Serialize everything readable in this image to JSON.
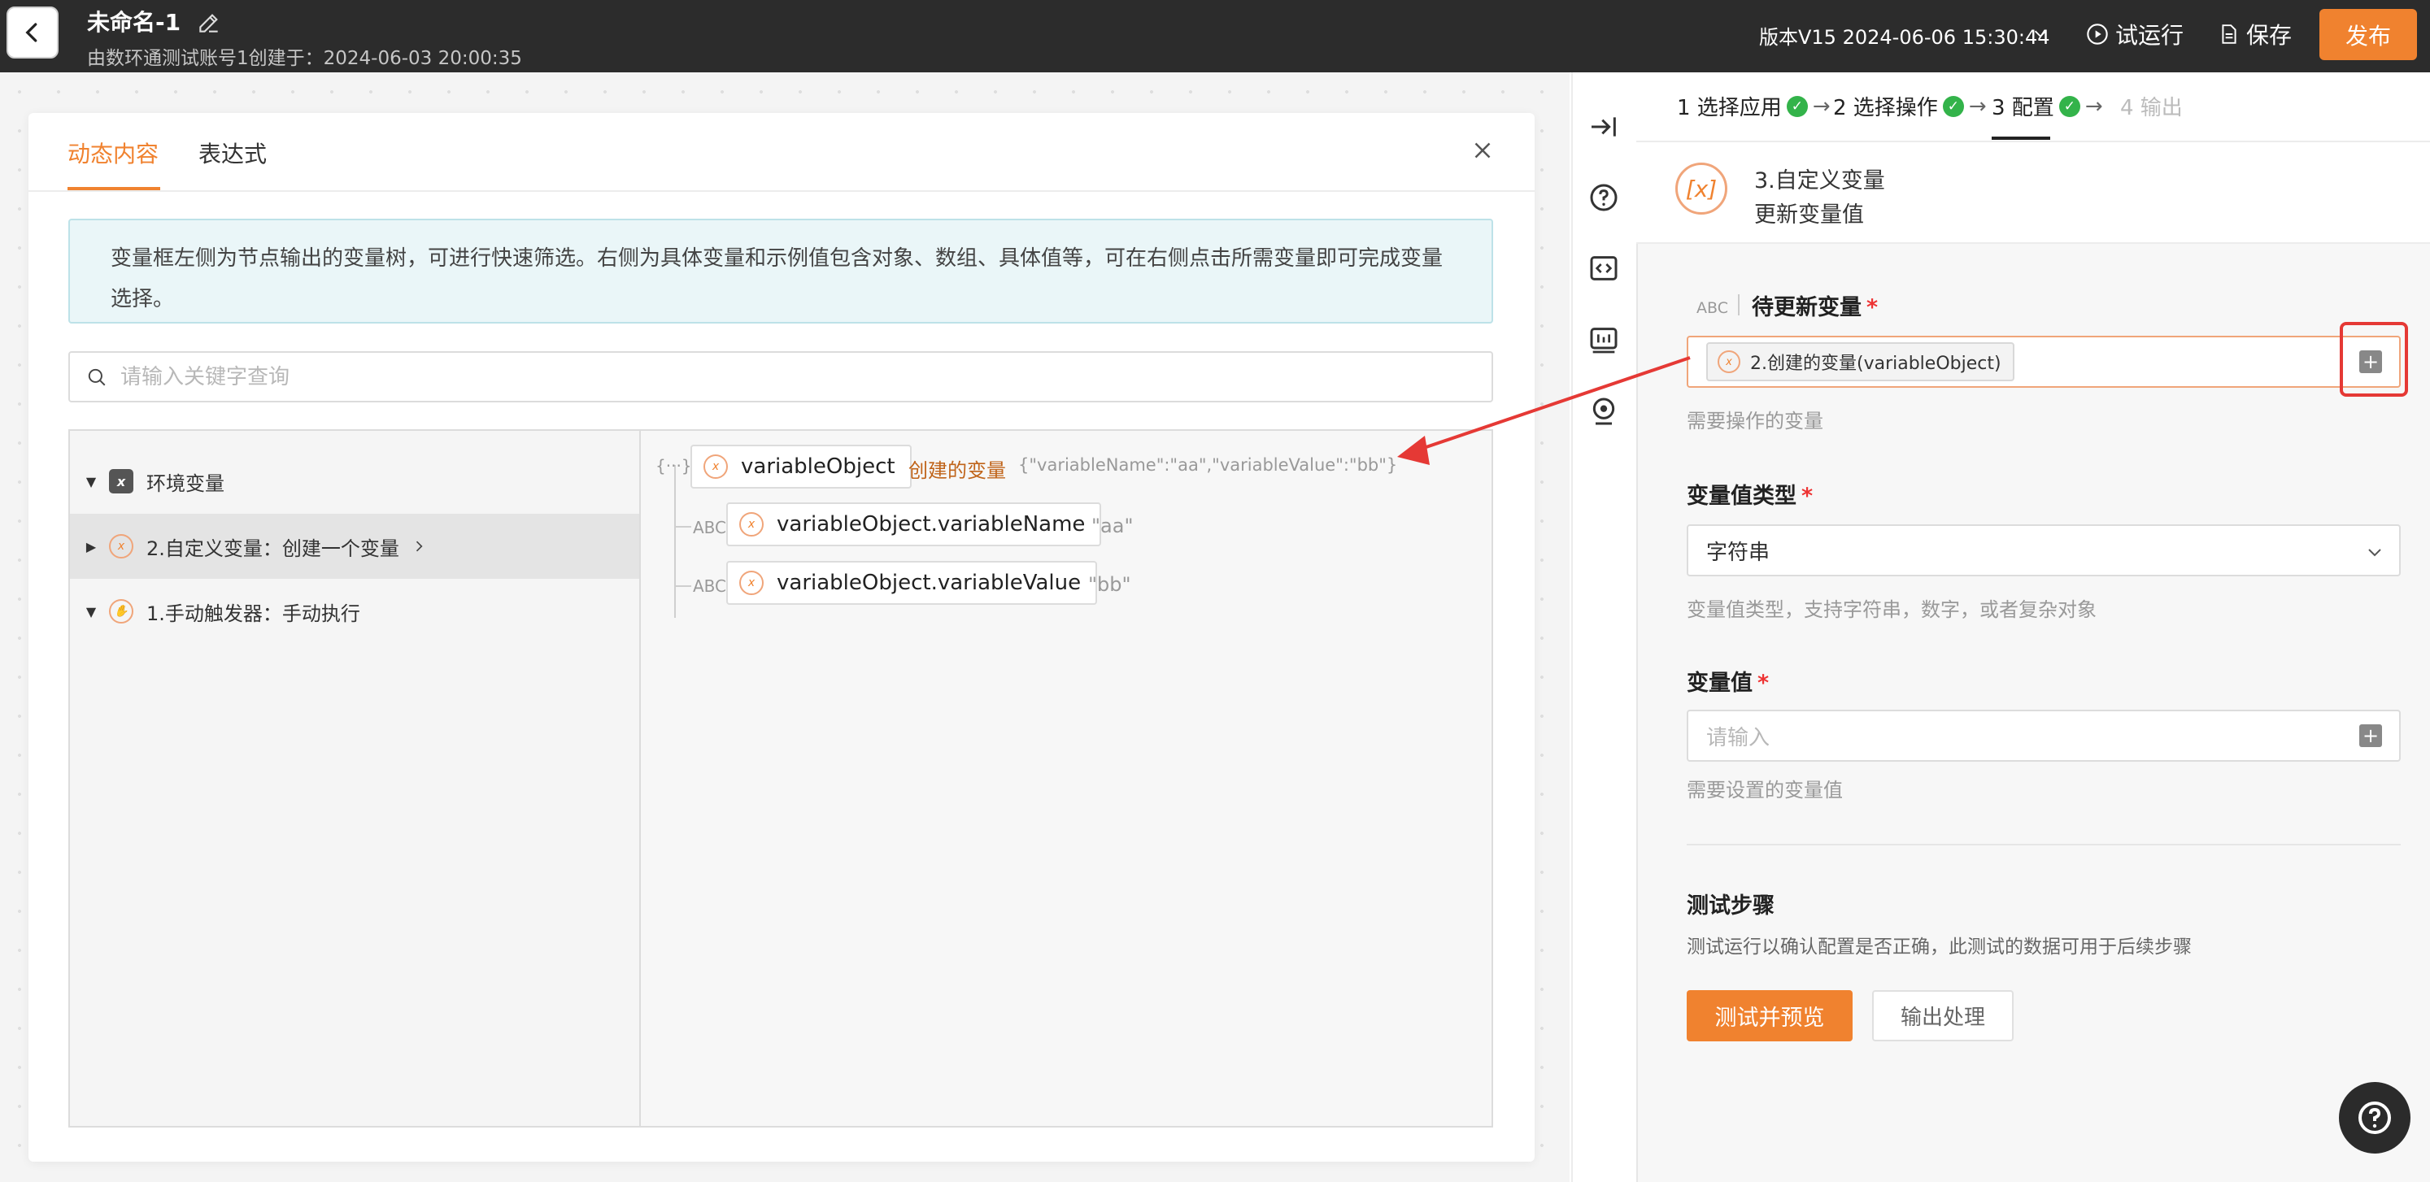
{
  "header": {
    "title": "未命名-1",
    "subtitle": "由数环通测试账号1创建于：2024-06-03 20:00:35",
    "version": "版本V15 2024-06-06 15:30:44",
    "test_run": "试运行",
    "save": "保存",
    "publish": "发布"
  },
  "modal": {
    "tabs": [
      "动态内容",
      "表达式"
    ],
    "info": "变量框左侧为节点输出的变量树，可进行快速筛选。右侧为具体变量和示例值包含对象、数组、具体值等，可在右侧点击所需变量即可完成变量选择。",
    "search_placeholder": "请输入关键字查询",
    "tree": [
      {
        "label": "环境变量"
      },
      {
        "label": "2.自定义变量：创建一个变量"
      },
      {
        "label": "1.手动触发器：手动执行"
      }
    ],
    "vars": {
      "root_type": "{···}",
      "root_name": "variableObject",
      "root_label": "创建的变量",
      "root_value": "{\"variableName\":\"aa\",\"variableValue\":\"bb\"}",
      "children": [
        {
          "type": "ABC",
          "name": "variableObject.variableName",
          "value": "\"aa\""
        },
        {
          "type": "ABC",
          "name": "variableObject.variableValue",
          "value": "\"bb\""
        }
      ]
    }
  },
  "steps": [
    {
      "label": "1 选择应用"
    },
    {
      "label": "2 选择操作"
    },
    {
      "label": "3 配置"
    },
    {
      "label": "4 输出"
    }
  ],
  "node": {
    "title": "3.自定义变量",
    "subtitle": "更新变量值"
  },
  "form": {
    "target_var": {
      "type_badge": "ABC",
      "label": "待更新变量",
      "chip": "2.创建的变量(variableObject)",
      "hint": "需要操作的变量"
    },
    "value_type": {
      "label": "变量值类型",
      "value": "字符串",
      "hint": "变量值类型，支持字符串，数字，或者复杂对象"
    },
    "value": {
      "label": "变量值",
      "placeholder": "请输入",
      "hint": "需要设置的变量值"
    },
    "test": {
      "title": "测试步骤",
      "desc": "测试运行以确认配置是否正确，此测试的数据可用于后续步骤",
      "test_btn": "测试并预览",
      "output_btn": "输出处理"
    }
  }
}
